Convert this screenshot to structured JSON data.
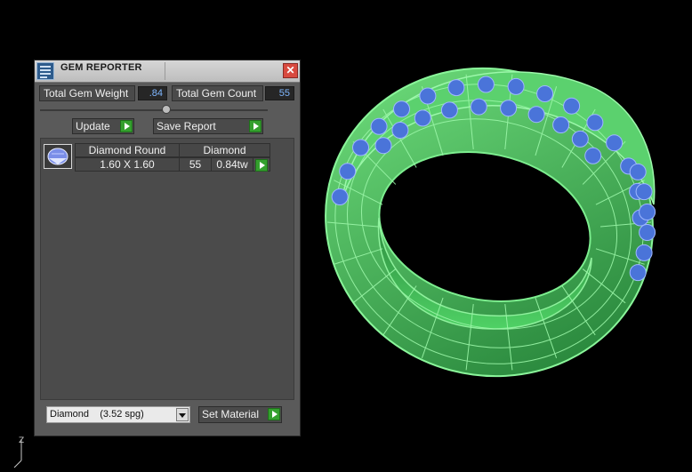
{
  "panel": {
    "title": "GEM REPORTER",
    "close_glyph": "✕",
    "total_gem_weight_label": "Total Gem Weight",
    "total_gem_weight_value": ".84",
    "total_gem_count_label": "Total Gem Count",
    "total_gem_count_value": "55",
    "update_label": "Update",
    "save_report_label": "Save Report",
    "rows": [
      {
        "shape": "Diamond Round",
        "material": "Diamond",
        "size": "1.60 X 1.60",
        "count": "55",
        "weight": "0.84tw"
      }
    ],
    "material_select_value": "Diamond    (3.52 spg)",
    "set_material_label": "Set Material"
  },
  "viewport": {
    "axis_label": "Z",
    "ring_color": "#43c25d",
    "gem_color": "#4a74d9"
  }
}
